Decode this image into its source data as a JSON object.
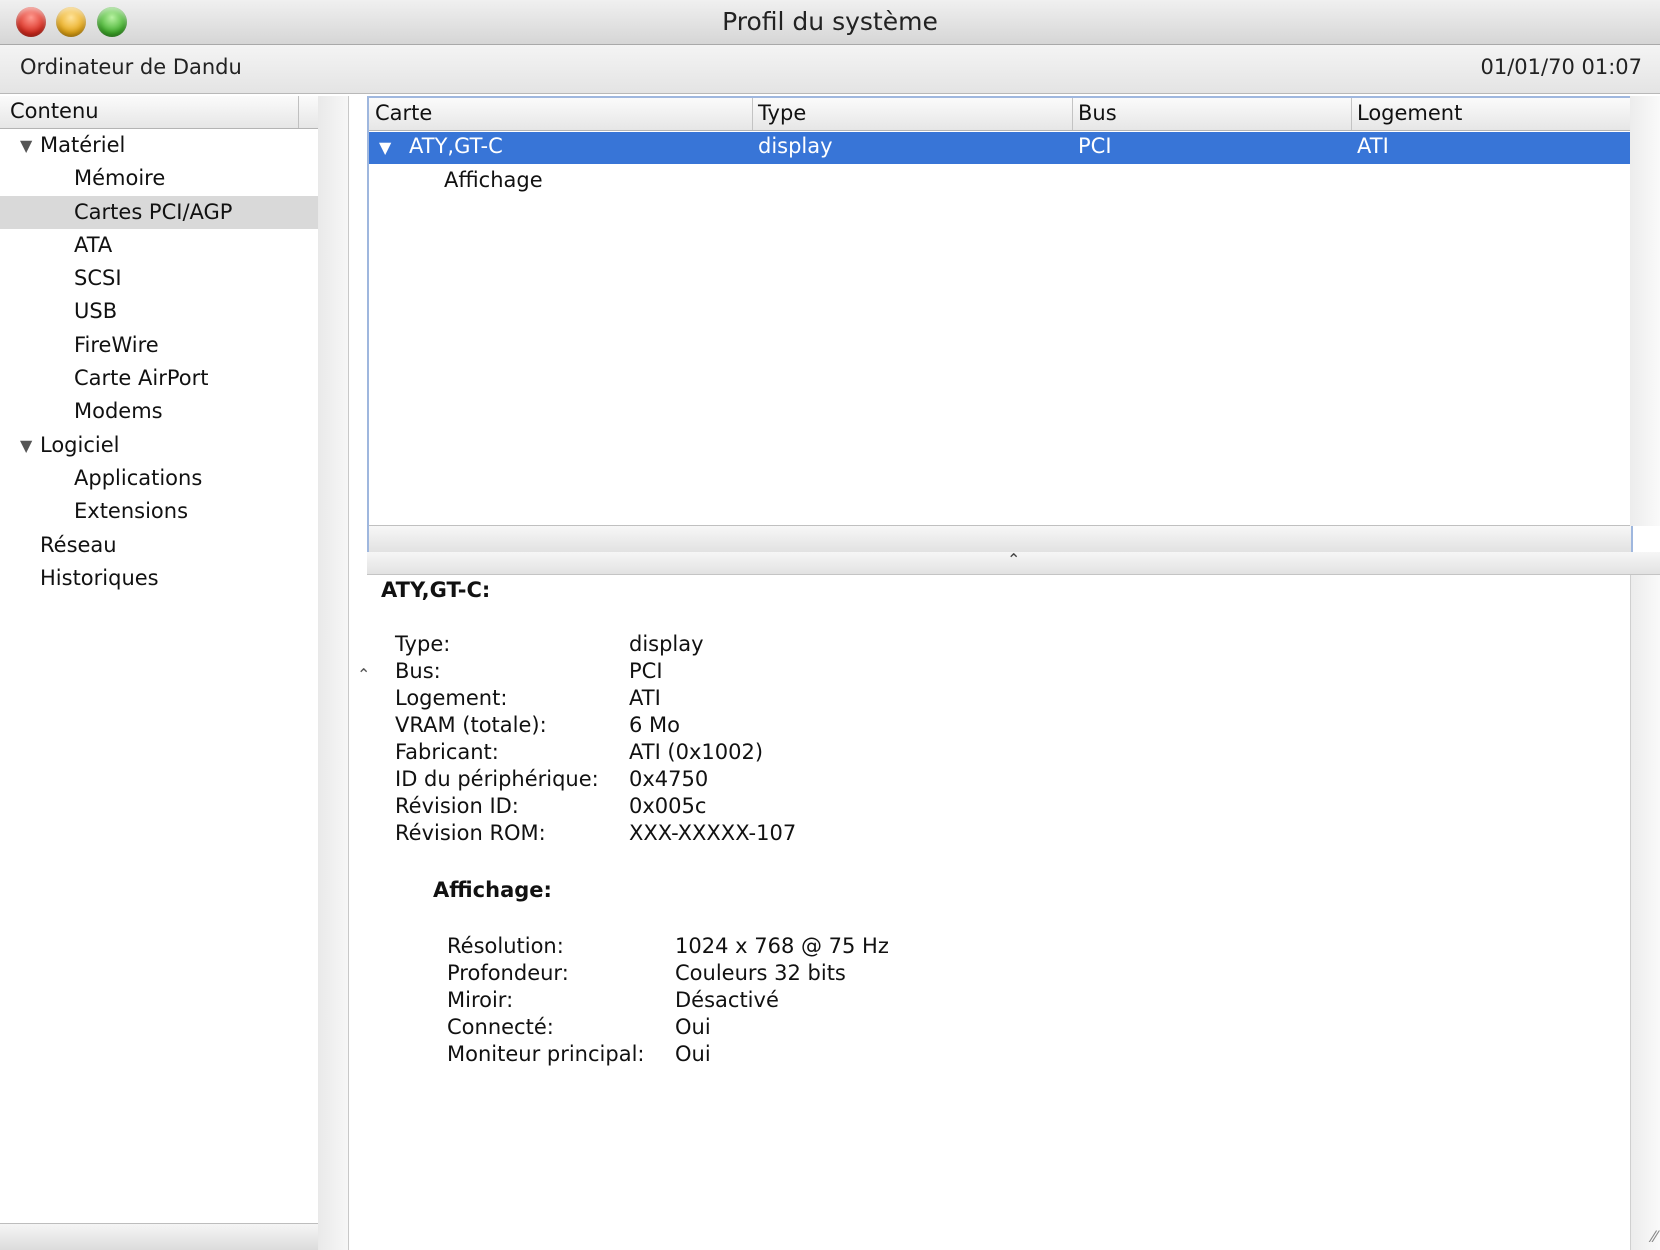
{
  "window": {
    "title": "Profil du système"
  },
  "infobar": {
    "computer": "Ordinateur de Dandu",
    "datetime": "01/01/70 01:07"
  },
  "sidebar": {
    "header": "Contenu",
    "items": [
      {
        "label": "Matériel",
        "level": 0,
        "expandable": true
      },
      {
        "label": "Mémoire",
        "level": 1
      },
      {
        "label": "Cartes PCI/AGP",
        "level": 1,
        "selected": true
      },
      {
        "label": "ATA",
        "level": 1
      },
      {
        "label": "SCSI",
        "level": 1
      },
      {
        "label": "USB",
        "level": 1
      },
      {
        "label": "FireWire",
        "level": 1
      },
      {
        "label": "Carte AirPort",
        "level": 1
      },
      {
        "label": "Modems",
        "level": 1
      },
      {
        "label": "Logiciel",
        "level": 0,
        "expandable": true
      },
      {
        "label": "Applications",
        "level": 1
      },
      {
        "label": "Extensions",
        "level": 1
      },
      {
        "label": "Réseau",
        "level": 0
      },
      {
        "label": "Historiques",
        "level": 0
      }
    ]
  },
  "table": {
    "columns": [
      "Carte",
      "Type",
      "Bus",
      "Logement"
    ],
    "rows": [
      {
        "card": "ATY,GT-C",
        "type": "display",
        "bus": "PCI",
        "slot": "ATI",
        "selected": true
      },
      {
        "card": "Affichage",
        "type": "",
        "bus": "",
        "slot": ""
      }
    ]
  },
  "details": {
    "title": "ATY,GT-C:",
    "fields": [
      {
        "key": "Type:",
        "value": "display"
      },
      {
        "key": "Bus:",
        "value": "PCI"
      },
      {
        "key": "Logement:",
        "value": "ATI"
      },
      {
        "key": "VRAM (totale):",
        "value": "6 Mo"
      },
      {
        "key": "Fabricant:",
        "value": "ATI (0x1002)"
      },
      {
        "key": "ID du périphérique:",
        "value": "0x4750"
      },
      {
        "key": "Révision ID:",
        "value": "0x005c"
      },
      {
        "key": "Révision ROM:",
        "value": "XXX-XXXXX-107"
      }
    ],
    "sub_title": "Affichage:",
    "sub_fields": [
      {
        "key": "Résolution:",
        "value": "1024 x 768 @ 75 Hz"
      },
      {
        "key": "Profondeur:",
        "value": "Couleurs 32 bits"
      },
      {
        "key": "Miroir:",
        "value": "Désactivé"
      },
      {
        "key": "Connecté:",
        "value": "Oui"
      },
      {
        "key": "Moniteur principal:",
        "value": "Oui"
      }
    ]
  },
  "colors": {
    "selection": "#3875d7",
    "sidebar_selection": "#d9d9d9",
    "table_focus": "#9fb7de"
  },
  "icons": {
    "expand": "disclosure-triangle-down",
    "splitter": "chevron-up"
  }
}
